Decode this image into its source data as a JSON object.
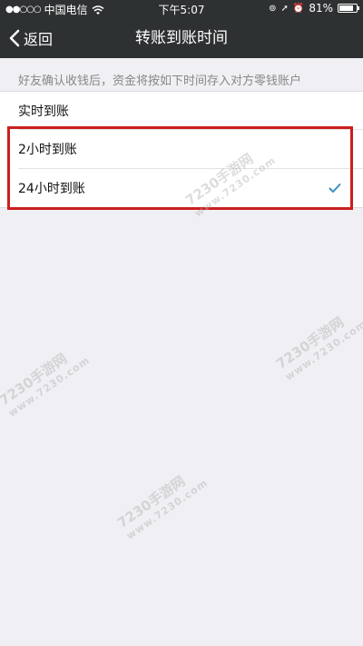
{
  "status_bar": {
    "signal": "●●○○○",
    "carrier": "中国电信",
    "time": "下午5:07",
    "battery_pct": "81%",
    "battery_level": 0.81
  },
  "nav": {
    "back_label": "返回",
    "title": "转账到账时间"
  },
  "hint": "好友确认收钱后，资金将按如下时间存入对方零钱账户",
  "options": [
    {
      "label": "实时到账",
      "selected": false
    },
    {
      "label": "2小时到账",
      "selected": false
    },
    {
      "label": "24小时到账",
      "selected": true
    }
  ],
  "watermark": {
    "text": "7230手游网",
    "url": "www.7230.com"
  },
  "colors": {
    "nav_bg": "#2e3132",
    "page_bg": "#efeff4",
    "check": "#3c8fc6",
    "highlight": "#cc1e1e"
  }
}
